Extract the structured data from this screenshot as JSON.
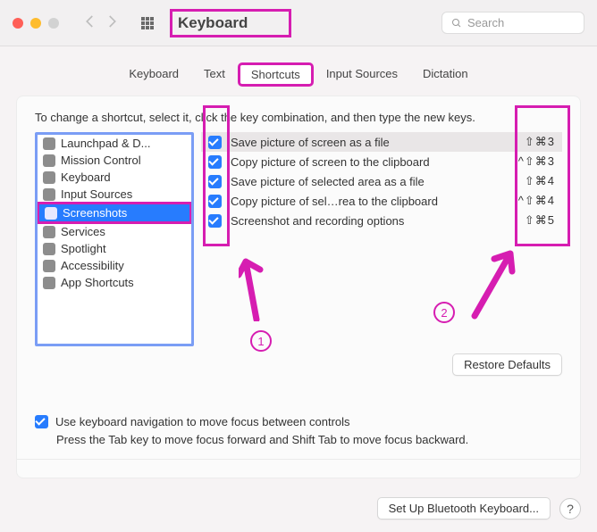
{
  "window": {
    "title": "Keyboard"
  },
  "search": {
    "placeholder": "Search"
  },
  "tabs": [
    {
      "label": "Keyboard",
      "active": false
    },
    {
      "label": "Text",
      "active": false
    },
    {
      "label": "Shortcuts",
      "active": true
    },
    {
      "label": "Input Sources",
      "active": false
    },
    {
      "label": "Dictation",
      "active": false
    }
  ],
  "instruction": "To change a shortcut, select it, click the key combination, and then type the new keys.",
  "categories": [
    {
      "label": "Launchpad & D..."
    },
    {
      "label": "Mission Control"
    },
    {
      "label": "Keyboard"
    },
    {
      "label": "Input Sources"
    },
    {
      "label": "Screenshots",
      "selected": true
    },
    {
      "label": "Services"
    },
    {
      "label": "Spotlight"
    },
    {
      "label": "Accessibility"
    },
    {
      "label": "App Shortcuts"
    }
  ],
  "shortcuts": [
    {
      "checked": true,
      "label": "Save picture of screen as a file",
      "keys": "⇧⌘3",
      "selected": true
    },
    {
      "checked": true,
      "label": "Copy picture of screen to the clipboard",
      "keys": "^⇧⌘3"
    },
    {
      "checked": true,
      "label": "Save picture of selected area as a file",
      "keys": "⇧⌘4"
    },
    {
      "checked": true,
      "label": "Copy picture of sel…rea to the clipboard",
      "keys": "^⇧⌘4"
    },
    {
      "checked": true,
      "label": "Screenshot and recording options",
      "keys": "⇧⌘5"
    }
  ],
  "restore_button": "Restore Defaults",
  "kb_nav": {
    "checkbox_label": "Use keyboard navigation to move focus between controls",
    "subtext": "Press the Tab key to move focus forward and Shift Tab to move focus backward."
  },
  "bottom_buttons": {
    "bluetooth": "Set Up Bluetooth Keyboard...",
    "help": "?"
  },
  "annotations": {
    "n1": "1",
    "n2": "2"
  }
}
